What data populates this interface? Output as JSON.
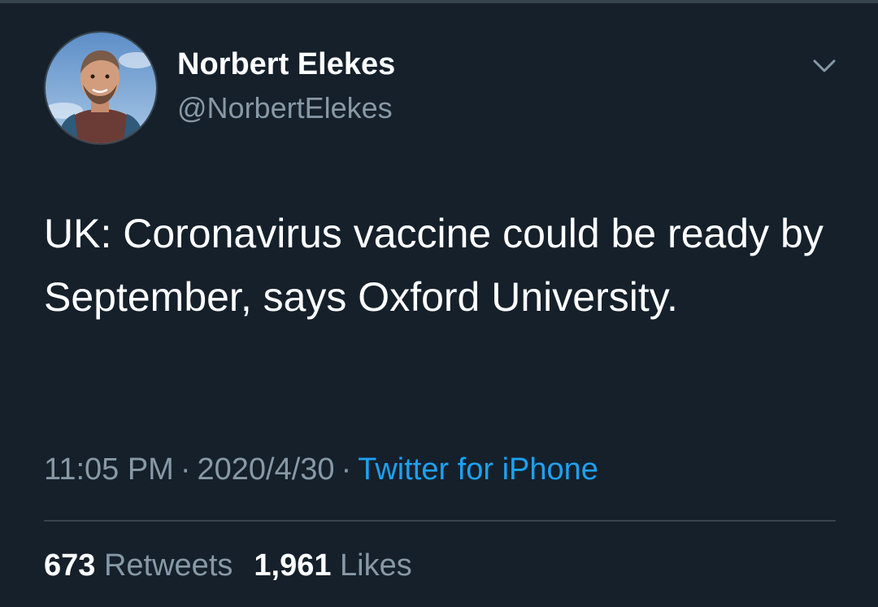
{
  "tweet": {
    "author": {
      "display_name": "Norbert Elekes",
      "handle": "@NorbertElekes"
    },
    "text": "UK: Coronavirus vaccine could be ready by September, says Oxford University.",
    "meta": {
      "time": "11:05 PM",
      "date": "2020/4/30",
      "separator": "·",
      "source": "Twitter for iPhone"
    },
    "stats": {
      "retweets_count": "673",
      "retweets_label": "Retweets",
      "likes_count": "1,961",
      "likes_label": "Likes"
    },
    "menu_icon": "chevron-down-icon",
    "colors": {
      "background": "#15202b",
      "text": "#ffffff",
      "secondary_text": "#8899a6",
      "link": "#1da1f2",
      "divider": "#38444d"
    }
  }
}
